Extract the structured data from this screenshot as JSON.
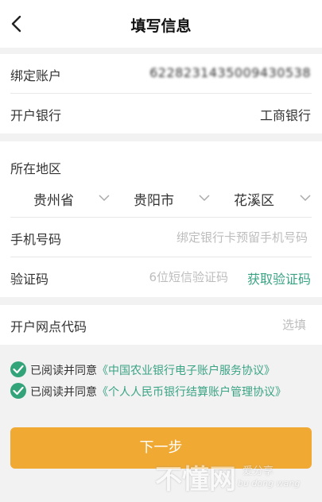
{
  "nav": {
    "title": "填写信息"
  },
  "account": {
    "label": "绑定账户",
    "value": "6228231435009430538"
  },
  "bank": {
    "label": "开户银行",
    "value": "工商银行"
  },
  "region": {
    "label": "所在地区",
    "province": "贵州省",
    "city": "贵阳市",
    "district": "花溪区"
  },
  "phone": {
    "label": "手机号码",
    "placeholder": "绑定银行卡预留手机号码"
  },
  "code": {
    "label": "验证码",
    "placeholder": "6位短信验证码",
    "send_label": "获取验证码"
  },
  "branch": {
    "label": "开户网点代码",
    "placeholder": "选填"
  },
  "agreements": [
    {
      "prefix": "已阅读并同意",
      "link": "《中国农业银行电子账户服务协议》"
    },
    {
      "prefix": "已阅读并同意",
      "link": "《个人人民币银行结算账户管理协议》"
    }
  ],
  "next_button": {
    "label": "下一步"
  },
  "watermark": {
    "main": "不懂网",
    "sub": "爱分享",
    "pinyin": "bu dong wang"
  },
  "colors": {
    "accent": "#3aa384",
    "button": "#f0a933",
    "check": "#33a37a"
  }
}
